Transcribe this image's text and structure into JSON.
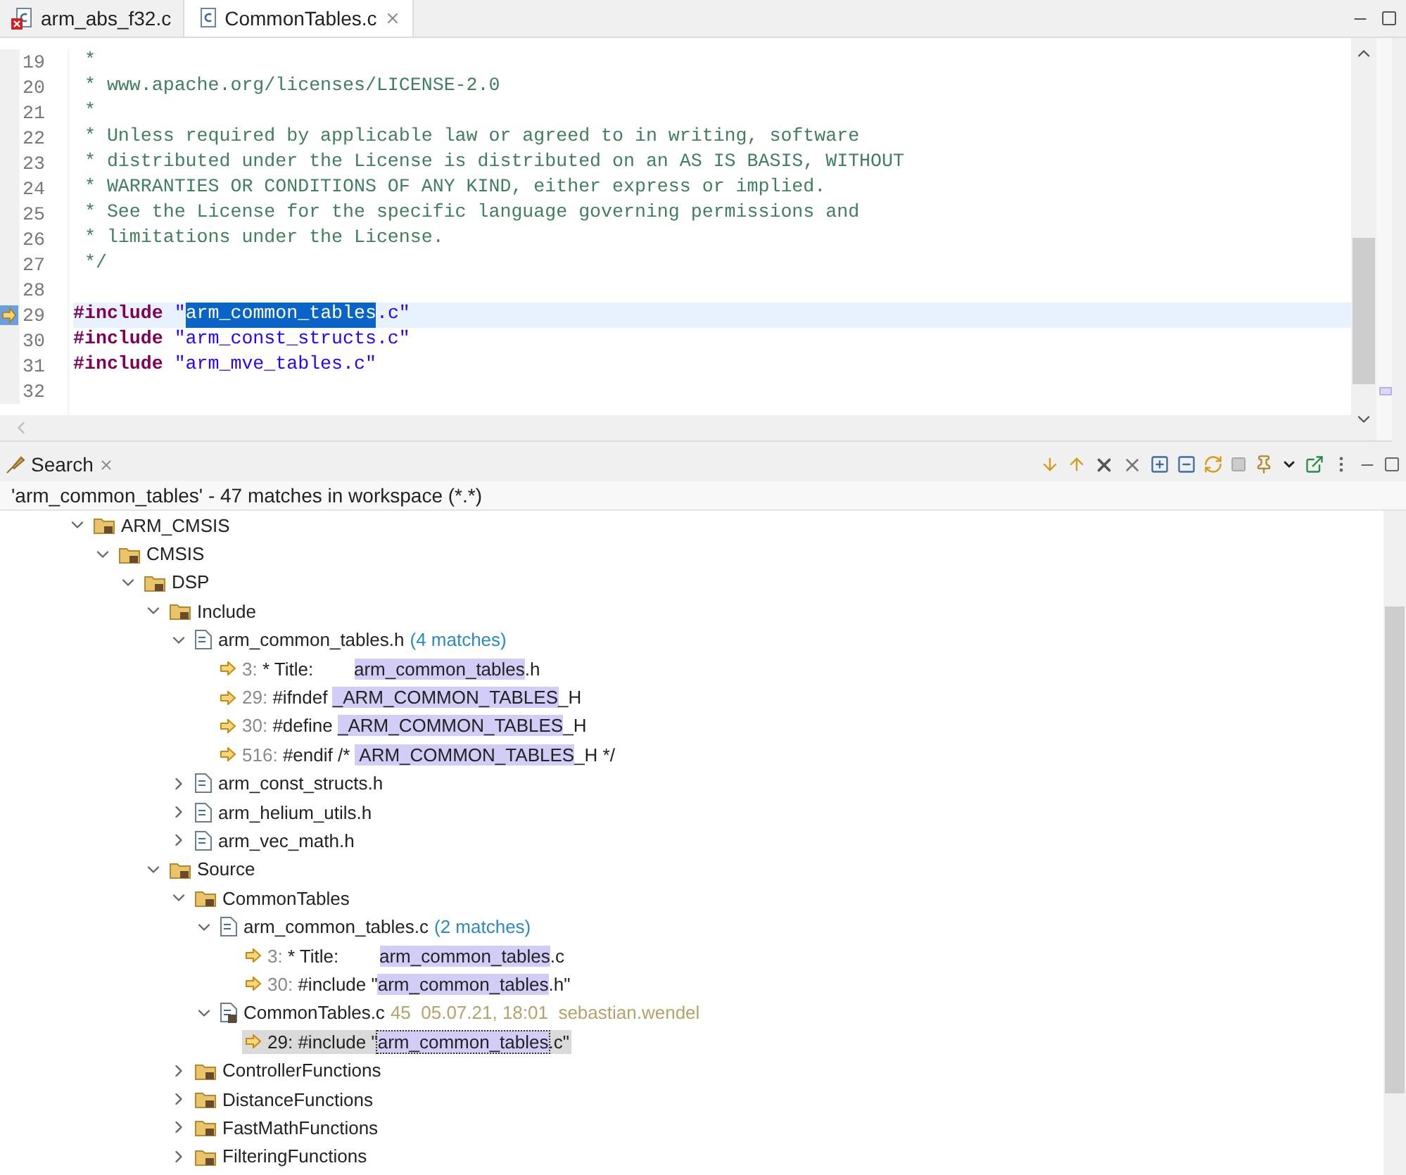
{
  "editor": {
    "tabs": [
      {
        "label": "arm_abs_f32.c",
        "selected": false,
        "error": true
      },
      {
        "label": "CommonTables.c",
        "selected": true,
        "error": false
      }
    ],
    "lines": [
      {
        "number": "19",
        "kind": "comment",
        "text": " *"
      },
      {
        "number": "20",
        "kind": "comment",
        "text": " * www.apache.org/licenses/LICENSE-2.0"
      },
      {
        "number": "21",
        "kind": "comment",
        "text": " *"
      },
      {
        "number": "22",
        "kind": "comment",
        "text": " * Unless required by applicable law or agreed to in writing, software"
      },
      {
        "number": "23",
        "kind": "comment",
        "text": " * distributed under the License is distributed on an AS IS BASIS, WITHOUT"
      },
      {
        "number": "24",
        "kind": "comment",
        "text": " * WARRANTIES OR CONDITIONS OF ANY KIND, either express or implied."
      },
      {
        "number": "25",
        "kind": "comment",
        "text": " * See the License for the specific language governing permissions and"
      },
      {
        "number": "26",
        "kind": "comment",
        "text": " * limitations under the License."
      },
      {
        "number": "27",
        "kind": "comment",
        "text": " */"
      },
      {
        "number": "28",
        "kind": "blank"
      },
      {
        "number": "29",
        "kind": "include",
        "current": true,
        "directive": "#include",
        "segments": [
          {
            "text": "\"",
            "selected": false
          },
          {
            "text": "arm_common_tables",
            "selected": true
          },
          {
            "text": ".c\"",
            "selected": false
          }
        ]
      },
      {
        "number": "30",
        "kind": "include",
        "current": false,
        "directive": "#include",
        "segments": [
          {
            "text": "\"arm_const_structs.c\"",
            "selected": false
          }
        ]
      },
      {
        "number": "31",
        "kind": "include",
        "current": false,
        "directive": "#include",
        "segments": [
          {
            "text": "\"arm_mve_tables.c\"",
            "selected": false
          }
        ]
      },
      {
        "number": "32",
        "kind": "blank"
      }
    ]
  },
  "search": {
    "title": "Search",
    "summary": "'arm_common_tables' - 47 matches in workspace (*.*)",
    "tree": [
      {
        "kind": "folder",
        "label": "ARM_CMSIS",
        "expanded": true,
        "children": [
          {
            "kind": "folder",
            "label": "CMSIS",
            "expanded": true,
            "children": [
              {
                "kind": "folder",
                "label": "DSP",
                "expanded": true,
                "children": [
                  {
                    "kind": "folder",
                    "label": "Include",
                    "expanded": true,
                    "children": [
                      {
                        "kind": "file",
                        "label": "arm_common_tables.h",
                        "count": "(4 matches)",
                        "expanded": true,
                        "children": [
                          {
                            "kind": "match",
                            "line": "3:",
                            "selected": false,
                            "segments": [
                              {
                                "text": "* Title:        ",
                                "match": false
                              },
                              {
                                "text": "arm_common_tables",
                                "match": true
                              },
                              {
                                "text": ".h",
                                "match": false
                              }
                            ]
                          },
                          {
                            "kind": "match",
                            "line": "29:",
                            "selected": false,
                            "segments": [
                              {
                                "text": "#ifndef ",
                                "match": false
                              },
                              {
                                "text": "_ARM_COMMON_TABLES",
                                "match": true
                              },
                              {
                                "text": "_H",
                                "match": false
                              }
                            ]
                          },
                          {
                            "kind": "match",
                            "line": "30:",
                            "selected": false,
                            "segments": [
                              {
                                "text": "#define ",
                                "match": false
                              },
                              {
                                "text": "_ARM_COMMON_TABLES",
                                "match": true
                              },
                              {
                                "text": "_H",
                                "match": false
                              }
                            ]
                          },
                          {
                            "kind": "match",
                            "line": "516:",
                            "selected": false,
                            "segments": [
                              {
                                "text": "#endif /* ",
                                "match": false
                              },
                              {
                                "text": " ARM_COMMON_TABLES",
                                "match": true
                              },
                              {
                                "text": "_H */",
                                "match": false
                              }
                            ]
                          }
                        ]
                      },
                      {
                        "kind": "file",
                        "label": "arm_const_structs.h",
                        "expanded": false
                      },
                      {
                        "kind": "file",
                        "label": "arm_helium_utils.h",
                        "expanded": false
                      },
                      {
                        "kind": "file",
                        "label": "arm_vec_math.h",
                        "expanded": false
                      }
                    ]
                  },
                  {
                    "kind": "folder",
                    "label": "Source",
                    "expanded": true,
                    "children": [
                      {
                        "kind": "folder",
                        "label": "CommonTables",
                        "expanded": true,
                        "children": [
                          {
                            "kind": "file",
                            "label": "arm_common_tables.c",
                            "count": "(2 matches)",
                            "expanded": true,
                            "children": [
                              {
                                "kind": "match",
                                "line": "3:",
                                "selected": false,
                                "segments": [
                                  {
                                    "text": "* Title:        ",
                                    "match": false
                                  },
                                  {
                                    "text": "arm_common_tables",
                                    "match": true
                                  },
                                  {
                                    "text": ".c",
                                    "match": false
                                  }
                                ]
                              },
                              {
                                "kind": "match",
                                "line": "30:",
                                "selected": false,
                                "segments": [
                                  {
                                    "text": "#include \"",
                                    "match": false
                                  },
                                  {
                                    "text": "arm_common_tables",
                                    "match": true
                                  },
                                  {
                                    "text": ".h\"",
                                    "match": false
                                  }
                                ]
                              }
                            ]
                          },
                          {
                            "kind": "file",
                            "label": "CommonTables.c",
                            "info": "45  05.07.21, 18:01  sebastian.wendel",
                            "expanded": true,
                            "children": [
                              {
                                "kind": "match",
                                "line": "29:",
                                "selected": true,
                                "segments": [
                                  {
                                    "text": "#include \"",
                                    "match": false
                                  },
                                  {
                                    "text": "arm_common_tables",
                                    "match": true
                                  },
                                  {
                                    "text": ".c\"",
                                    "match": false
                                  }
                                ]
                              }
                            ]
                          }
                        ]
                      },
                      {
                        "kind": "folder",
                        "label": "ControllerFunctions",
                        "expanded": false
                      },
                      {
                        "kind": "folder",
                        "label": "DistanceFunctions",
                        "expanded": false
                      },
                      {
                        "kind": "folder",
                        "label": "FastMathFunctions",
                        "expanded": false
                      },
                      {
                        "kind": "folder",
                        "label": "FilteringFunctions",
                        "expanded": false
                      }
                    ]
                  }
                ]
              }
            ]
          }
        ]
      }
    ]
  }
}
